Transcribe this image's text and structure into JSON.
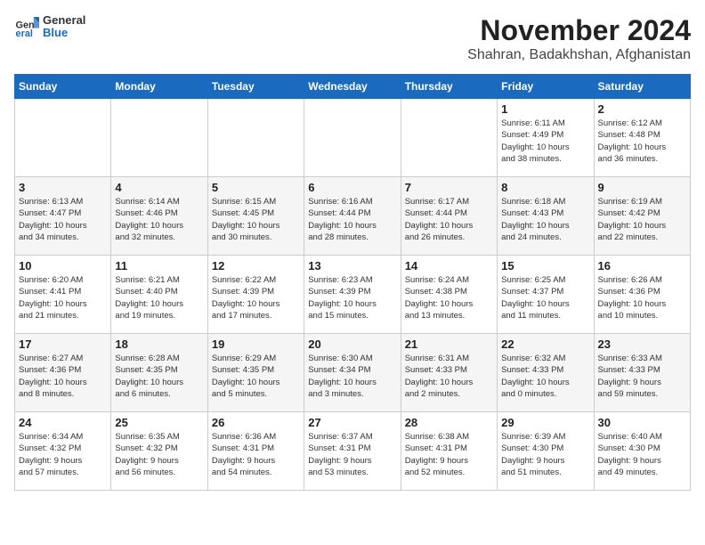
{
  "header": {
    "logo_general": "General",
    "logo_blue": "Blue",
    "month_title": "November 2024",
    "location": "Shahran, Badakhshan, Afghanistan"
  },
  "days_of_week": [
    "Sunday",
    "Monday",
    "Tuesday",
    "Wednesday",
    "Thursday",
    "Friday",
    "Saturday"
  ],
  "weeks": [
    [
      {
        "day": "",
        "content": ""
      },
      {
        "day": "",
        "content": ""
      },
      {
        "day": "",
        "content": ""
      },
      {
        "day": "",
        "content": ""
      },
      {
        "day": "",
        "content": ""
      },
      {
        "day": "1",
        "content": "Sunrise: 6:11 AM\nSunset: 4:49 PM\nDaylight: 10 hours\nand 38 minutes."
      },
      {
        "day": "2",
        "content": "Sunrise: 6:12 AM\nSunset: 4:48 PM\nDaylight: 10 hours\nand 36 minutes."
      }
    ],
    [
      {
        "day": "3",
        "content": "Sunrise: 6:13 AM\nSunset: 4:47 PM\nDaylight: 10 hours\nand 34 minutes."
      },
      {
        "day": "4",
        "content": "Sunrise: 6:14 AM\nSunset: 4:46 PM\nDaylight: 10 hours\nand 32 minutes."
      },
      {
        "day": "5",
        "content": "Sunrise: 6:15 AM\nSunset: 4:45 PM\nDaylight: 10 hours\nand 30 minutes."
      },
      {
        "day": "6",
        "content": "Sunrise: 6:16 AM\nSunset: 4:44 PM\nDaylight: 10 hours\nand 28 minutes."
      },
      {
        "day": "7",
        "content": "Sunrise: 6:17 AM\nSunset: 4:44 PM\nDaylight: 10 hours\nand 26 minutes."
      },
      {
        "day": "8",
        "content": "Sunrise: 6:18 AM\nSunset: 4:43 PM\nDaylight: 10 hours\nand 24 minutes."
      },
      {
        "day": "9",
        "content": "Sunrise: 6:19 AM\nSunset: 4:42 PM\nDaylight: 10 hours\nand 22 minutes."
      }
    ],
    [
      {
        "day": "10",
        "content": "Sunrise: 6:20 AM\nSunset: 4:41 PM\nDaylight: 10 hours\nand 21 minutes."
      },
      {
        "day": "11",
        "content": "Sunrise: 6:21 AM\nSunset: 4:40 PM\nDaylight: 10 hours\nand 19 minutes."
      },
      {
        "day": "12",
        "content": "Sunrise: 6:22 AM\nSunset: 4:39 PM\nDaylight: 10 hours\nand 17 minutes."
      },
      {
        "day": "13",
        "content": "Sunrise: 6:23 AM\nSunset: 4:39 PM\nDaylight: 10 hours\nand 15 minutes."
      },
      {
        "day": "14",
        "content": "Sunrise: 6:24 AM\nSunset: 4:38 PM\nDaylight: 10 hours\nand 13 minutes."
      },
      {
        "day": "15",
        "content": "Sunrise: 6:25 AM\nSunset: 4:37 PM\nDaylight: 10 hours\nand 11 minutes."
      },
      {
        "day": "16",
        "content": "Sunrise: 6:26 AM\nSunset: 4:36 PM\nDaylight: 10 hours\nand 10 minutes."
      }
    ],
    [
      {
        "day": "17",
        "content": "Sunrise: 6:27 AM\nSunset: 4:36 PM\nDaylight: 10 hours\nand 8 minutes."
      },
      {
        "day": "18",
        "content": "Sunrise: 6:28 AM\nSunset: 4:35 PM\nDaylight: 10 hours\nand 6 minutes."
      },
      {
        "day": "19",
        "content": "Sunrise: 6:29 AM\nSunset: 4:35 PM\nDaylight: 10 hours\nand 5 minutes."
      },
      {
        "day": "20",
        "content": "Sunrise: 6:30 AM\nSunset: 4:34 PM\nDaylight: 10 hours\nand 3 minutes."
      },
      {
        "day": "21",
        "content": "Sunrise: 6:31 AM\nSunset: 4:33 PM\nDaylight: 10 hours\nand 2 minutes."
      },
      {
        "day": "22",
        "content": "Sunrise: 6:32 AM\nSunset: 4:33 PM\nDaylight: 10 hours\nand 0 minutes."
      },
      {
        "day": "23",
        "content": "Sunrise: 6:33 AM\nSunset: 4:33 PM\nDaylight: 9 hours\nand 59 minutes."
      }
    ],
    [
      {
        "day": "24",
        "content": "Sunrise: 6:34 AM\nSunset: 4:32 PM\nDaylight: 9 hours\nand 57 minutes."
      },
      {
        "day": "25",
        "content": "Sunrise: 6:35 AM\nSunset: 4:32 PM\nDaylight: 9 hours\nand 56 minutes."
      },
      {
        "day": "26",
        "content": "Sunrise: 6:36 AM\nSunset: 4:31 PM\nDaylight: 9 hours\nand 54 minutes."
      },
      {
        "day": "27",
        "content": "Sunrise: 6:37 AM\nSunset: 4:31 PM\nDaylight: 9 hours\nand 53 minutes."
      },
      {
        "day": "28",
        "content": "Sunrise: 6:38 AM\nSunset: 4:31 PM\nDaylight: 9 hours\nand 52 minutes."
      },
      {
        "day": "29",
        "content": "Sunrise: 6:39 AM\nSunset: 4:30 PM\nDaylight: 9 hours\nand 51 minutes."
      },
      {
        "day": "30",
        "content": "Sunrise: 6:40 AM\nSunset: 4:30 PM\nDaylight: 9 hours\nand 49 minutes."
      }
    ]
  ]
}
